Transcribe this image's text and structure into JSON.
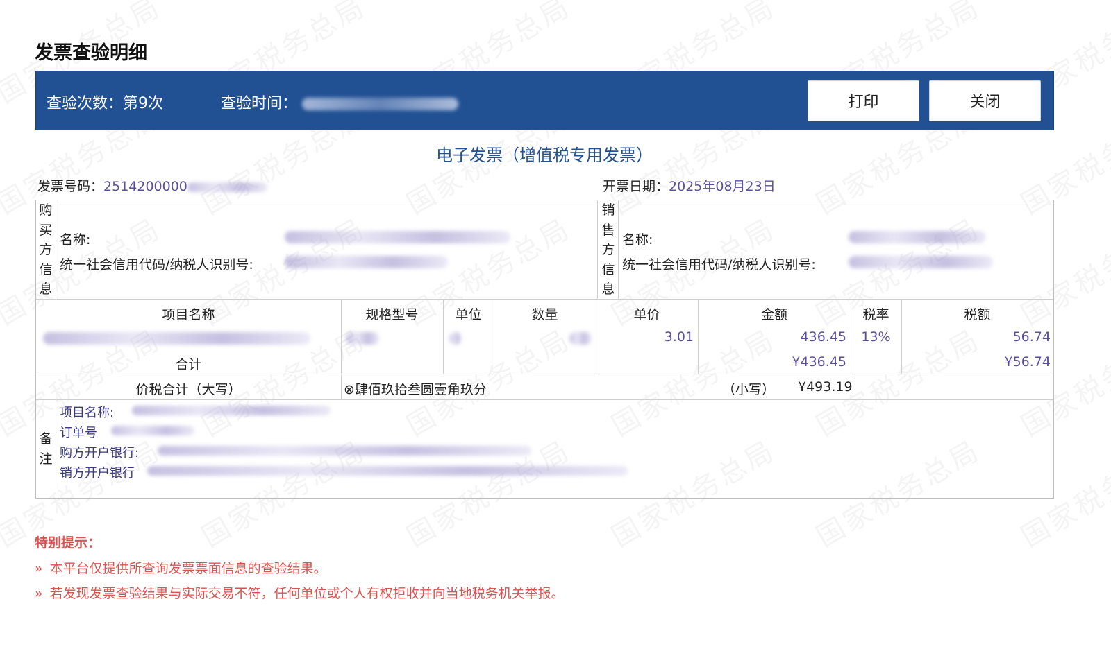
{
  "watermark": "国家税务总局",
  "page_title": "发票查验明细",
  "header": {
    "check_count_label": "查验次数：第9次",
    "check_time_label": "查验时间："
  },
  "buttons": {
    "print": "打印",
    "close": "关闭"
  },
  "invoice": {
    "type_title": "电子发票（增值税专用发票）",
    "number_label": "发票号码：",
    "number_value": "2514200000",
    "date_label": "开票日期：",
    "date_value": "2025年08月23日"
  },
  "buyer": {
    "side_label": [
      "购",
      "买",
      "方",
      "信",
      "息"
    ],
    "name_label": "名称:",
    "tax_id_label": "统一社会信用代码/纳税人识别号:"
  },
  "seller": {
    "side_label": [
      "销",
      "售",
      "方",
      "信",
      "息"
    ],
    "name_label": "名称:",
    "tax_id_label": "统一社会信用代码/纳税人识别号:"
  },
  "items": {
    "headers": {
      "name": "项目名称",
      "spec": "规格型号",
      "unit": "单位",
      "qty": "数量",
      "price": "单价",
      "amount": "金额",
      "rate": "税率",
      "tax": "税额"
    },
    "row": {
      "price": "3.01",
      "amount": "436.45",
      "rate": "13%",
      "tax": "56.74"
    },
    "subtotal_label": "合计",
    "subtotal_amount": "¥436.45",
    "subtotal_tax": "¥56.74"
  },
  "total": {
    "label": "价税合计（大写）",
    "upper": "⊗肆佰玖拾叁圆壹角玖分",
    "lower_label": "（小写）",
    "lower_value": "¥493.19"
  },
  "remarks": {
    "side_label": [
      "备",
      "注"
    ],
    "lines": [
      "项目名称:",
      "订单号",
      "购方开户银行:",
      "销方开户银行"
    ]
  },
  "tips": {
    "title": "特别提示：",
    "items": [
      "本平台仅提供所查询发票票面信息的查验结果。",
      "若发现发票查验结果与实际交易不符，任何单位或个人有权拒收并向当地税务机关举报。"
    ],
    "bullet": "»"
  }
}
